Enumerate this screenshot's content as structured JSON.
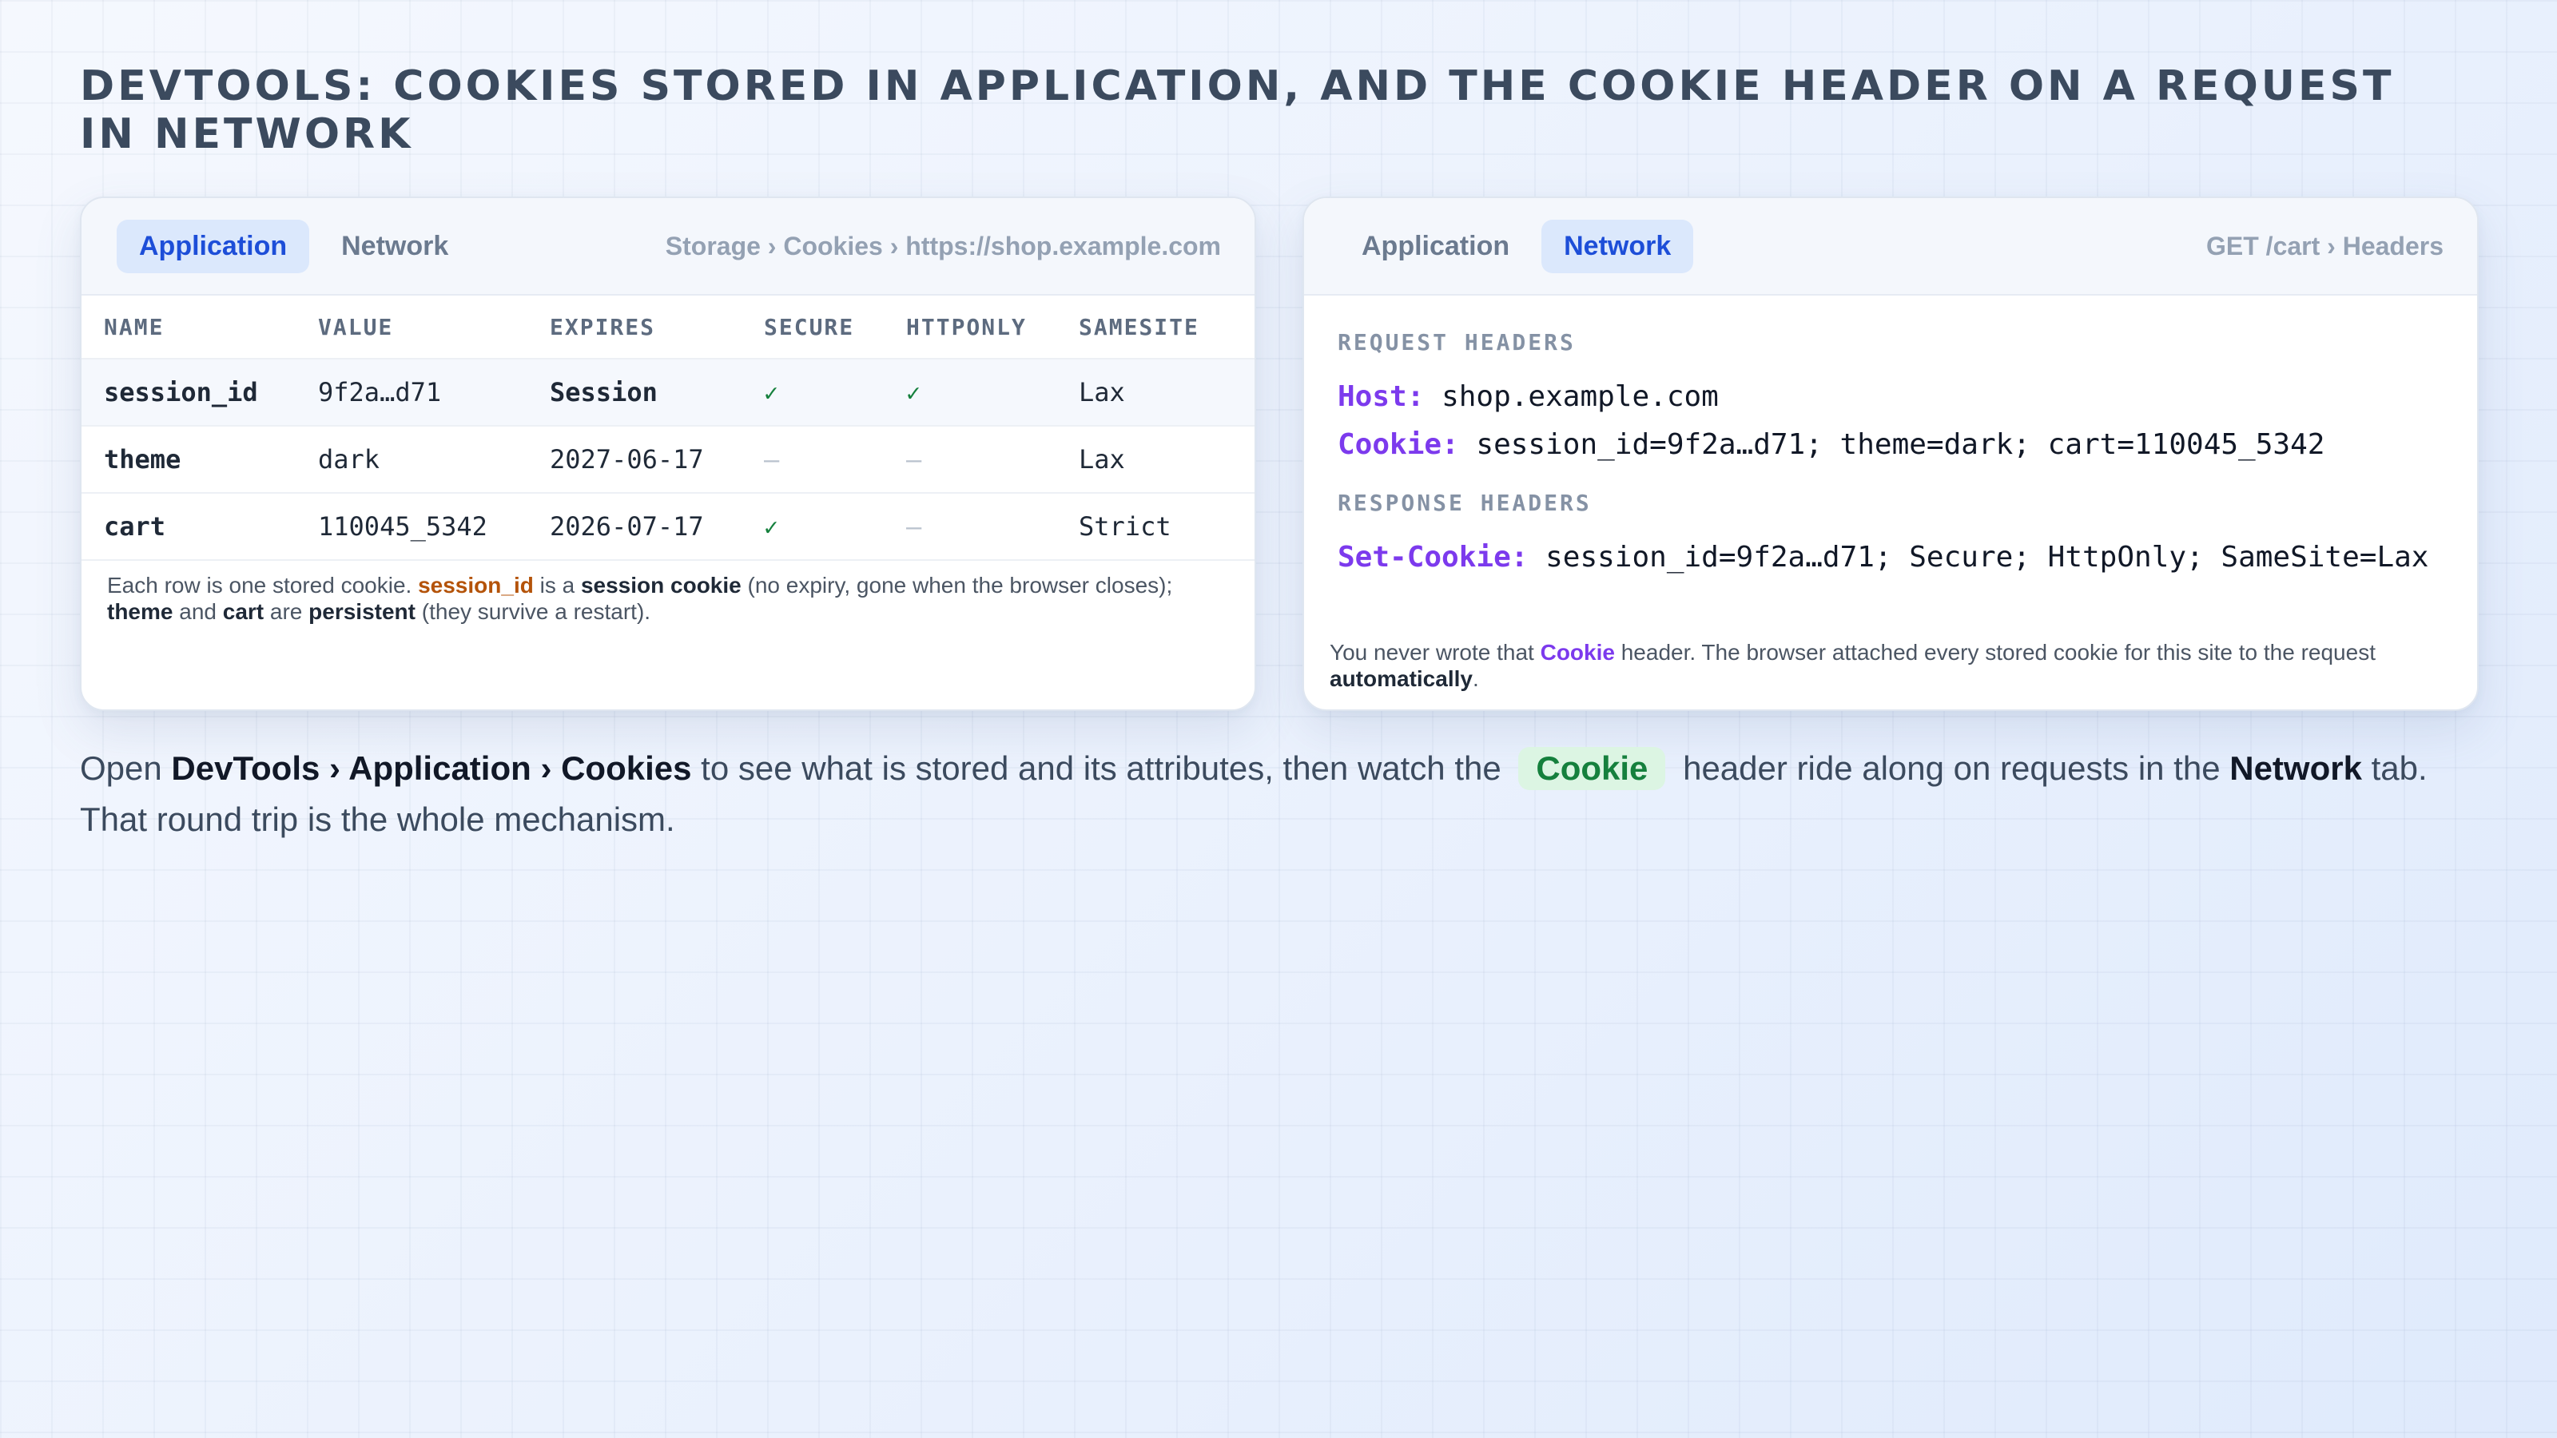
{
  "title": "DevTools: cookies stored in Application, and the Cookie header on a request in Network",
  "left_panel": {
    "tabs": [
      "Application",
      "Network"
    ],
    "active_tab": "Application",
    "breadcrumb": "Storage › Cookies › https://shop.example.com",
    "columns": [
      "NAME",
      "VALUE",
      "EXPIRES",
      "SECURE",
      "HTTPONLY",
      "SAMESITE"
    ],
    "rows": [
      {
        "name": "session_id",
        "value": "9f2a…d71",
        "expires": "Session",
        "secure": "✓",
        "httponly": "✓",
        "samesite": "Lax"
      },
      {
        "name": "theme",
        "value": "dark",
        "expires": "2027-06-17",
        "secure": "—",
        "httponly": "—",
        "samesite": "Lax"
      },
      {
        "name": "cart",
        "value": "110045_5342",
        "expires": "2026-07-17",
        "secure": "✓",
        "httponly": "—",
        "samesite": "Strict"
      }
    ],
    "note": {
      "p1": "Each row is one stored cookie. ",
      "b1": "session_id",
      "p2": " is a ",
      "b2": "session cookie",
      "p3": " (no expiry, gone when the browser closes); ",
      "b3": "theme",
      "p4": " and ",
      "b4": "cart",
      "p5": " are ",
      "b5": "persistent",
      "p6": " (they survive a restart)."
    }
  },
  "right_panel": {
    "tabs": [
      "Application",
      "Network"
    ],
    "active_tab": "Network",
    "breadcrumb": "GET /cart › Headers",
    "request_label": "REQUEST HEADERS",
    "request_headers": [
      {
        "key": "Host:",
        "value": "shop.example.com"
      },
      {
        "key": "Cookie:",
        "value": "session_id=9f2a…d71; theme=dark; cart=110045_5342"
      }
    ],
    "response_label": "RESPONSE HEADERS",
    "response_headers": [
      {
        "key": "Set-Cookie:",
        "value": "session_id=9f2a…d71; Secure; HttpOnly; SameSite=Lax"
      }
    ],
    "note": {
      "p1": "You never wrote that ",
      "b1": "Cookie",
      "p2": " header. The browser attached every stored cookie for this site to the request ",
      "b2": "automatically",
      "p3": "."
    }
  },
  "caption": {
    "t1": "Open ",
    "b1": "DevTools › Application › Cookies",
    "t2": " to see what is stored and its attributes, then watch the ",
    "pill": "Cookie",
    "t3": " header ride along on requests in the ",
    "b2": "Network",
    "t4": " tab. That round trip is the whole mechanism."
  }
}
